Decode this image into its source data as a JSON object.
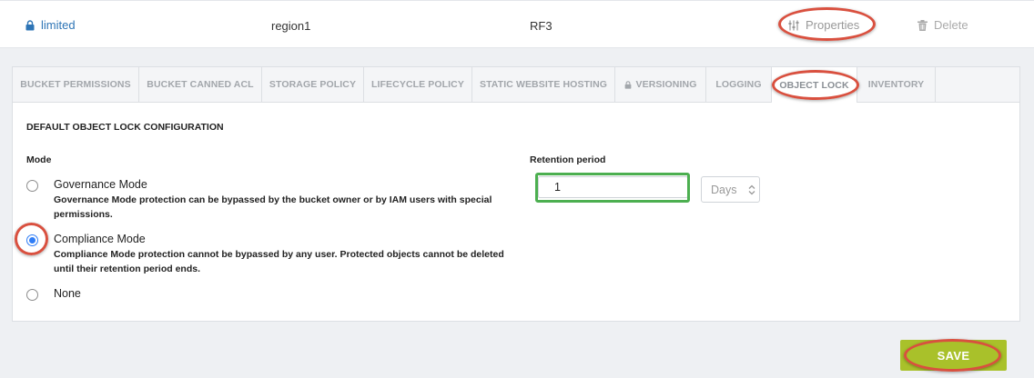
{
  "bucket_row": {
    "name": "limited",
    "region": "region1",
    "policy": "RF3",
    "properties_label": "Properties",
    "delete_label": "Delete"
  },
  "tabs": [
    {
      "label": "BUCKET PERMISSIONS",
      "active": false,
      "locked": false
    },
    {
      "label": "BUCKET CANNED ACL",
      "active": false,
      "locked": false
    },
    {
      "label": "STORAGE POLICY",
      "active": false,
      "locked": false
    },
    {
      "label": "LIFECYCLE POLICY",
      "active": false,
      "locked": false
    },
    {
      "label": "STATIC WEBSITE HOSTING",
      "active": false,
      "locked": false
    },
    {
      "label": "VERSIONING",
      "active": false,
      "locked": true
    },
    {
      "label": "LOGGING",
      "active": false,
      "locked": false
    },
    {
      "label": "OBJECT LOCK",
      "active": true,
      "locked": false
    },
    {
      "label": "INVENTORY",
      "active": false,
      "locked": false
    }
  ],
  "object_lock": {
    "section_title": "DEFAULT OBJECT LOCK CONFIGURATION",
    "mode_label": "Mode",
    "modes": [
      {
        "title": "Governance Mode",
        "description": "Governance Mode protection can be bypassed by the bucket owner or by IAM users with special permissions.",
        "checked": false
      },
      {
        "title": "Compliance Mode",
        "description": "Compliance Mode protection cannot be bypassed by any user. Protected objects cannot be deleted until their retention period ends.",
        "checked": true
      },
      {
        "title": "None",
        "description": "",
        "checked": false
      }
    ],
    "retention_label": "Retention period",
    "retention_value": "1",
    "retention_unit": "Days"
  },
  "save_label": "SAVE",
  "colors": {
    "link": "#2e75b6",
    "save": "#a9c12a",
    "radio": "#2f7df6",
    "annotation_red": "#d9503f",
    "annotation_green": "#4caf50"
  }
}
